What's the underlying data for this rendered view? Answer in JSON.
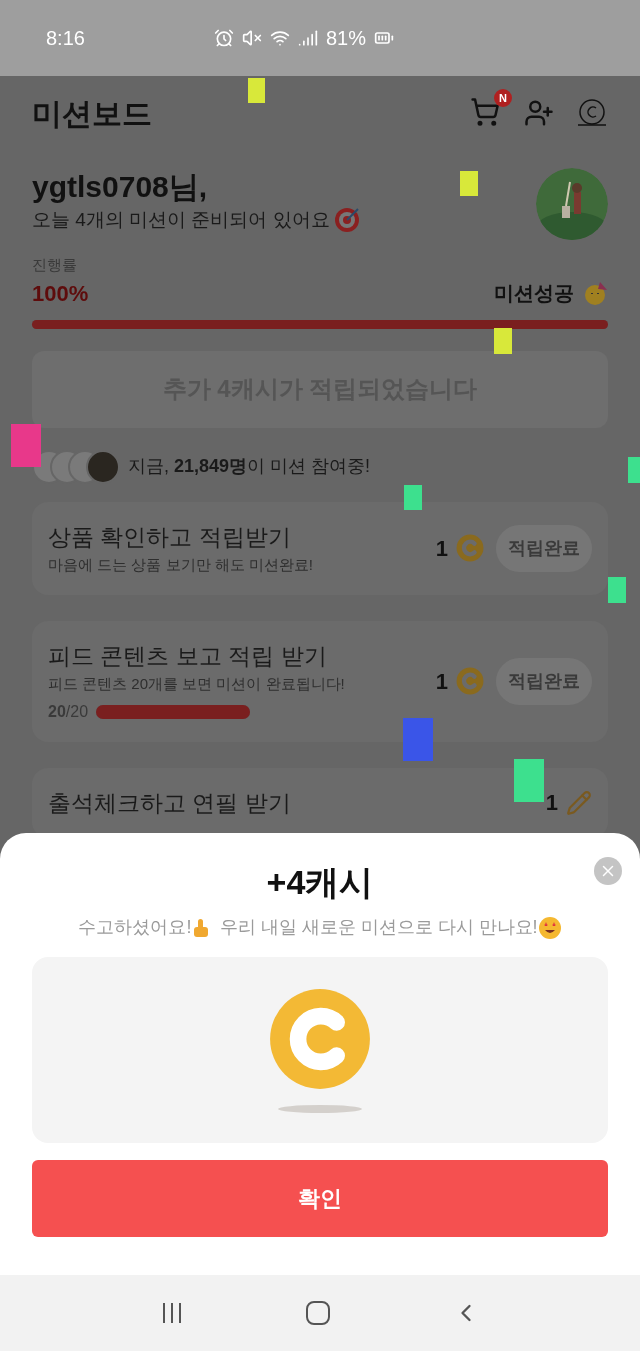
{
  "status_bar": {
    "time": "8:16",
    "battery": "81%"
  },
  "header": {
    "title": "미션보드",
    "cart_badge": "N"
  },
  "greeting": {
    "name_line": "ygtls0708님,",
    "message": "오늘 4개의 미션이 준비되어 있어요"
  },
  "progress": {
    "label": "진행률",
    "percent": "100%",
    "status": "미션성공",
    "level": 1
  },
  "bonus_button": "추가 4캐시가 적립되었습니다",
  "participants": "지금, **21,849명**이 미션 참여중!",
  "missions": [
    {
      "title": "상품 확인하고 적립받기",
      "description": "마음에 드는 상품 보기만 해도 미션완료!",
      "reward": "1",
      "kind": "coin",
      "button": "적립완료"
    },
    {
      "title": "피드 콘텐츠 보고 적립 받기",
      "description": "피드 콘텐츠 20개를 보면 미션이 완료됩니다!",
      "counter": "**20**/20",
      "level": 1,
      "reward": "1",
      "kind": "coin",
      "button": "적립완료"
    },
    {
      "title": "출석체크하고 연필 받기",
      "reward": "1",
      "kind": "pencil"
    }
  ],
  "reward_sheet": {
    "title": "+4캐시",
    "message_1": "수고하셨어요!",
    "message_2": "우리 내일 새로운 미션으로 다시 만나요!",
    "confirm": "확인"
  }
}
